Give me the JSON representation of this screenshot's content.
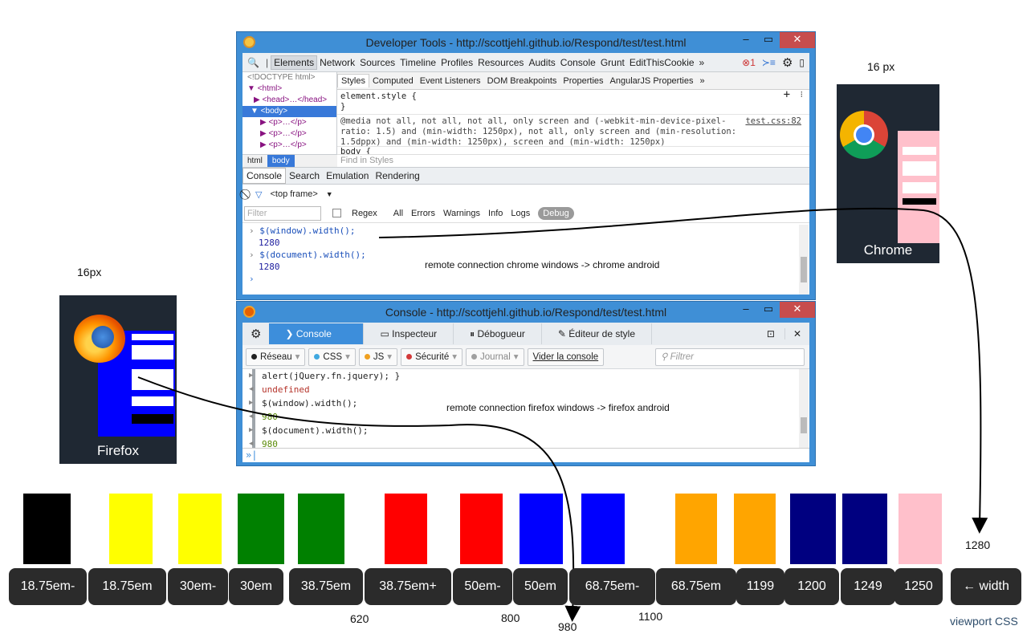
{
  "devtools": {
    "title": "Developer Tools - http://scottjehl.github.io/Respond/test/test.html",
    "tabs": [
      "Elements",
      "Network",
      "Sources",
      "Timeline",
      "Profiles",
      "Resources",
      "Audits",
      "Console",
      "Grunt",
      "EditThisCookie",
      "»"
    ],
    "error_count": "1",
    "dom_lines": [
      "<!DOCTYPE html>",
      "▼ <html>",
      "▶ <head>…</head>",
      "▼ <body>",
      "▶ <p>…</p>",
      "▶ <p>…</p>",
      "▶ <p>…</p>"
    ],
    "crumbs": [
      "html",
      "body"
    ],
    "style_tabs": [
      "Styles",
      "Computed",
      "Event Listeners",
      "DOM Breakpoints",
      "Properties",
      "AngularJS Properties",
      "»"
    ],
    "element_style": "element.style {",
    "element_style_close": "}",
    "media_rule": "@media not all, not all, not all, only screen and (-webkit-min-device-pixel-ratio: 1.5) and (min-width: 1250px), not all, only screen and (min-resolution: 1.5dppx) and (min-width: 1250px), screen and (min-width: 1250px)",
    "media_source": "test.css:82",
    "body_rule": "body {",
    "find_in_styles": "Find in Styles",
    "drawer_tabs": [
      "Console",
      "Search",
      "Emulation",
      "Rendering"
    ],
    "top_frame": "<top frame>",
    "filter_placeholder": "Filter",
    "regex_label": "Regex",
    "levels": [
      "All",
      "Errors",
      "Warnings",
      "Info",
      "Logs",
      "Debug"
    ],
    "console_lines": [
      {
        "cmd": "$(window).width();",
        "result": "1280"
      },
      {
        "cmd": "$(document).width();",
        "result": "1280"
      }
    ],
    "prompt": "›"
  },
  "chrome_note": "remote connection chrome windows -> chrome  android",
  "firefox_window": {
    "title": "Console - http://scottjehl.github.io/Respond/test/test.html",
    "tabs": [
      "Console",
      "Inspecteur",
      "Débogueur",
      "Éditeur de style"
    ],
    "filters": [
      {
        "label": "Réseau",
        "color": "#222222"
      },
      {
        "label": "CSS",
        "color": "#3fa8e0"
      },
      {
        "label": "JS",
        "color": "#f0a020"
      },
      {
        "label": "Sécurité",
        "color": "#d33a3a"
      },
      {
        "label": "Journal",
        "color": "#a0a0a0"
      }
    ],
    "clear_label": "Vider la console",
    "search_placeholder": "Filtrer",
    "lines": [
      {
        "text": "alert(jQuery.fn.jquery); }",
        "kind": "cmd"
      },
      {
        "text": "undefined",
        "kind": "undef"
      },
      {
        "text": "$(window).width();",
        "kind": "cmd"
      },
      {
        "text": "980",
        "kind": "num"
      },
      {
        "text": "$(document).width();",
        "kind": "cmd"
      },
      {
        "text": "980",
        "kind": "num"
      }
    ],
    "prompt": "»|"
  },
  "firefox_note": "remote connection firefox  windows -> firefox android",
  "chrome_phone": {
    "size": "16 px",
    "label": "Chrome"
  },
  "firefox_phone": {
    "size": "16px",
    "label": "Firefox"
  },
  "swatches": [
    {
      "color": "#000000"
    },
    {
      "color": "#ffff00"
    },
    {
      "color": "#ffff00"
    },
    {
      "color": "#008000"
    },
    {
      "color": "#008000"
    },
    {
      "color": "#ff0000"
    },
    {
      "color": "#ff0000"
    },
    {
      "color": "#0000ff"
    },
    {
      "color": "#0000ff"
    },
    {
      "color": "#ffa500"
    },
    {
      "color": "#ffa500"
    },
    {
      "color": "#000080"
    },
    {
      "color": "#000080"
    },
    {
      "color": "#ffc0cb"
    }
  ],
  "breakpoints": [
    "18.75em-",
    "18.75em",
    "30em-",
    "30em",
    "38.75em",
    "38.75em+",
    "50em-",
    "50em",
    "68.75em-",
    "68.75em",
    "1199",
    "1200",
    "1249",
    "1250",
    "← width"
  ],
  "px_marks": [
    "620",
    "800",
    "980",
    "1100",
    "1280"
  ],
  "viewport_label": "viewport CSS"
}
